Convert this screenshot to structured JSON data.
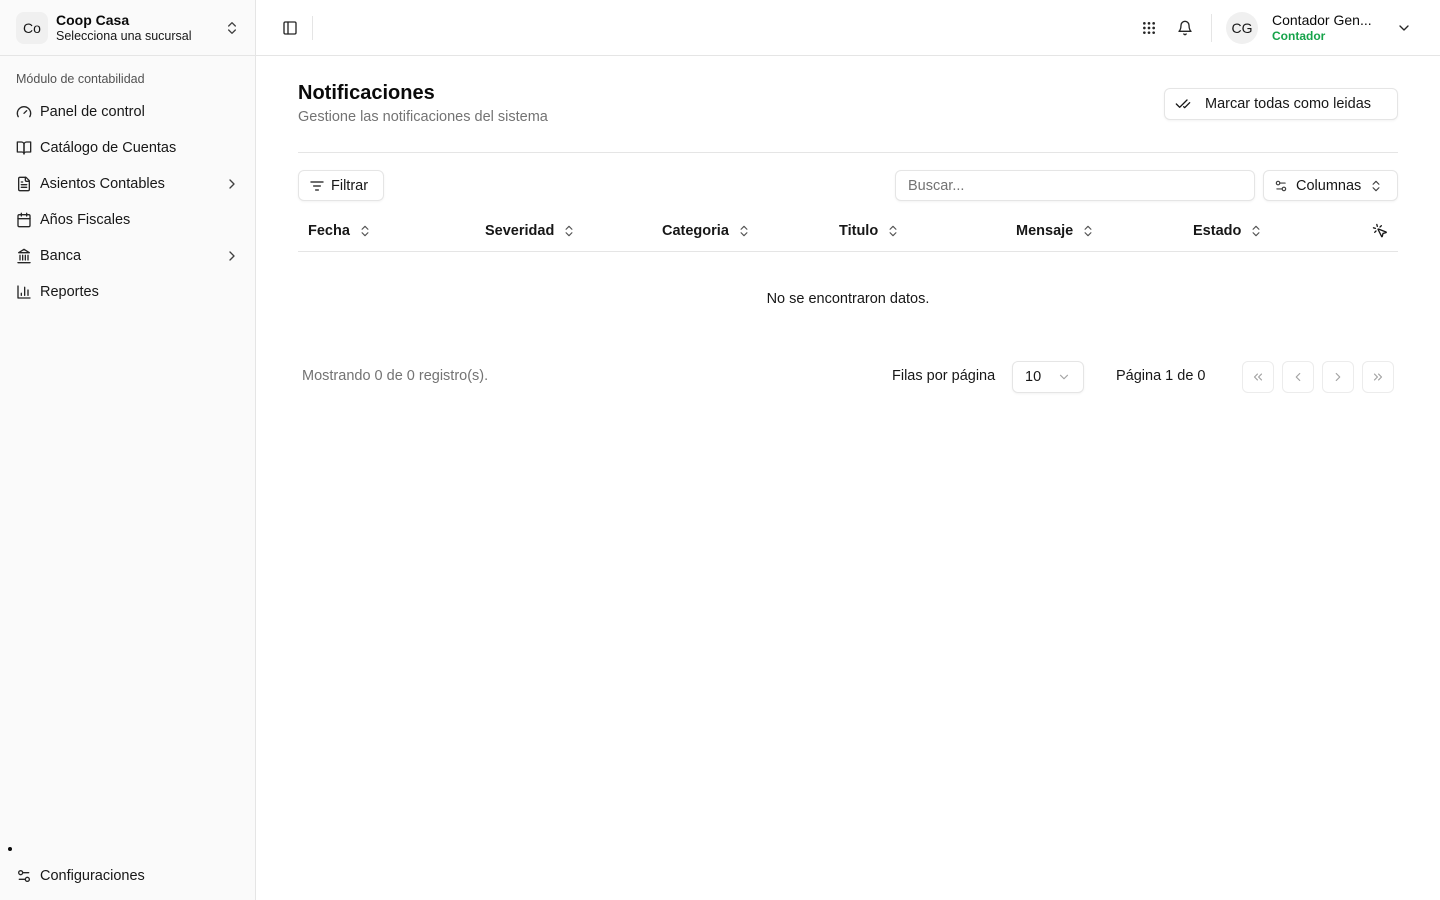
{
  "sidebar": {
    "org": {
      "avatar": "Co",
      "name": "Coop Casa",
      "branch": "Selecciona una sucursal"
    },
    "group_label": "Módulo de contabilidad",
    "items": [
      {
        "label": "Panel de control",
        "icon": "gauge-icon",
        "has_submenu": false
      },
      {
        "label": "Catálogo de Cuentas",
        "icon": "book-open-icon",
        "has_submenu": false
      },
      {
        "label": "Asientos Contables",
        "icon": "file-text-icon",
        "has_submenu": true
      },
      {
        "label": "Años Fiscales",
        "icon": "calendar-icon",
        "has_submenu": false
      },
      {
        "label": "Banca",
        "icon": "landmark-icon",
        "has_submenu": true
      },
      {
        "label": "Reportes",
        "icon": "bar-chart-icon",
        "has_submenu": false
      }
    ],
    "settings_label": "Configuraciones"
  },
  "header": {
    "user": {
      "initials": "CG",
      "name": "Contador Gen...",
      "role": "Contador",
      "role_color": "#16a34a"
    }
  },
  "main": {
    "title": "Notificaciones",
    "subtitle": "Gestione las notificaciones del sistema",
    "mark_all_label": "Marcar todas como leidas",
    "filter_label": "Filtrar",
    "search_placeholder": "Buscar...",
    "columns_label": "Columnas",
    "table": {
      "headers": [
        "Fecha",
        "Severidad",
        "Categoria",
        "Titulo",
        "Mensaje",
        "Estado"
      ],
      "empty_text": "No se encontraron datos."
    },
    "pagination": {
      "showing": "Mostrando 0 de 0 registro(s).",
      "rows_label": "Filas por página",
      "rows_value": "10",
      "page_info": "Página 1 de 0"
    }
  }
}
